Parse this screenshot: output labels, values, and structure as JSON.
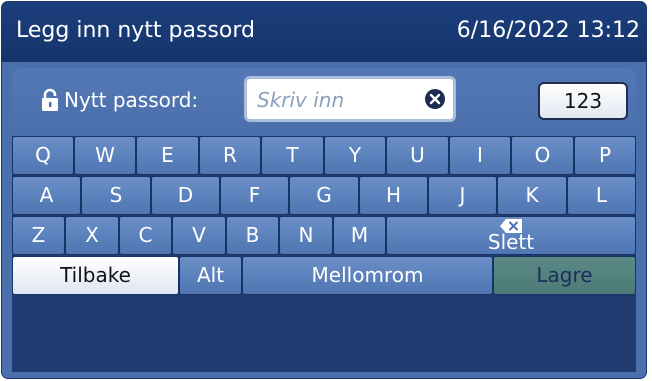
{
  "titlebar": {
    "title": "Legg inn nytt passord",
    "datetime": "6/16/2022 13:12"
  },
  "password_row": {
    "label": "Nytt passord:",
    "placeholder": "Skriv inn",
    "mode_button": "123"
  },
  "keyboard": {
    "row1": [
      "Q",
      "W",
      "E",
      "R",
      "T",
      "Y",
      "U",
      "I",
      "O",
      "P"
    ],
    "row2": [
      "A",
      "S",
      "D",
      "F",
      "G",
      "H",
      "J",
      "K",
      "L"
    ],
    "row3": [
      "Z",
      "X",
      "C",
      "V",
      "B",
      "N",
      "M"
    ],
    "delete_label": "Slett",
    "back_label": "Tilbake",
    "alt_label": "Alt",
    "space_label": "Mellomrom",
    "save_label": "Lagre"
  },
  "colors": {
    "titlebar": "#14346b",
    "panel": "#4a70ad",
    "key": "#5b80bb",
    "save_key": "#56847f",
    "back_key": "#f2f5fa"
  },
  "icons": {
    "lock": "lock-icon",
    "clear": "clear-icon",
    "delete": "backspace-icon"
  }
}
